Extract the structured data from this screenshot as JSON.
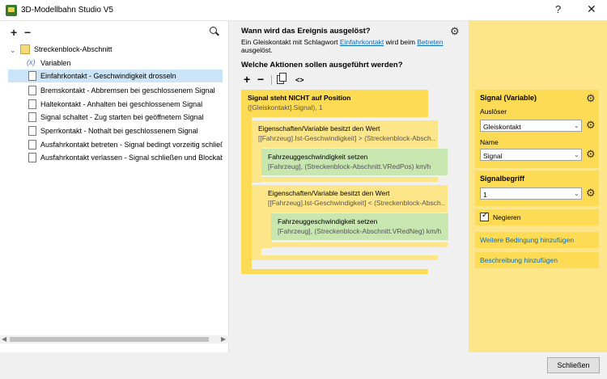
{
  "window": {
    "title": "3D-Modellbahn Studio V5",
    "help": "?",
    "close": "✕"
  },
  "tree": {
    "root": "Streckenblock-Abschnitt",
    "variables_icon": "(x)",
    "items": [
      {
        "label": "Variablen",
        "icon": "variable-icon"
      },
      {
        "label": "Einfahrkontakt - Geschwindigkeit drosseln",
        "selected": true
      },
      {
        "label": "Bremskontakt - Abbremsen bei geschlossenem Signal"
      },
      {
        "label": "Haltekontakt - Anhalten bei geschlossenem Signal"
      },
      {
        "label": "Signal schaltet - Zug starten bei geöffnetem Signal"
      },
      {
        "label": "Sperrkontakt - Nothalt bei geschlossenem Signal"
      },
      {
        "label": "Ausfahrkontakt betreten - Signal bedingt vorzeitig schließen"
      },
      {
        "label": "Ausfahrkontakt verlassen - Signal schließen und  Blockabschnitt freigeben"
      }
    ]
  },
  "event": {
    "heading": "Wann wird das Ereignis ausgelöst?",
    "desc_pre": "Ein Gleiskontakt mit Schlagwort ",
    "desc_link1": "Einfahrkontakt",
    "desc_mid": " wird beim ",
    "desc_link2": "Betreten",
    "desc_post": " ausgelöst."
  },
  "actions": {
    "heading": "Welche Aktionen sollen ausgeführt werden?",
    "code_label": "<>",
    "blocks": [
      {
        "title": "Signal steht NICHT auf Position",
        "sub": "([Gleiskontakt].Signal), 1"
      },
      {
        "title": "Eigenschaften/Variable besitzt den Wert",
        "sub": "[[Fahrzeug].Ist-Geschwindigkeit] > (Streckenblock-Absch..."
      },
      {
        "title": "Fahrzeuggeschwindigkeit setzen",
        "sub": "[Fahrzeug], (Streckenblock-Abschnitt.VRedPos) km/h"
      },
      {
        "title": "Eigenschaften/Variable besitzt den Wert",
        "sub": "[[Fahrzeug].Ist-Geschwindigkeit] < (Streckenblock-Absch..."
      },
      {
        "title": "Fahrzeuggeschwindigkeit setzen",
        "sub": "[Fahrzeug], (Streckenblock-Abschnitt.VRedNeg) km/h"
      }
    ]
  },
  "props": {
    "title": "Signal (Variable)",
    "trigger_label": "Auslöser",
    "trigger_value": "Gleiskontakt",
    "name_label": "Name",
    "name_value": "Signal",
    "signalbegriff_label": "Signalbegriff",
    "signalbegriff_value": "1",
    "negate_label": "Negieren",
    "add_condition": "Weitere Bedingung hinzufügen",
    "add_description": "Beschreibung hinzufügen"
  },
  "footer": {
    "close_label": "Schließen"
  }
}
